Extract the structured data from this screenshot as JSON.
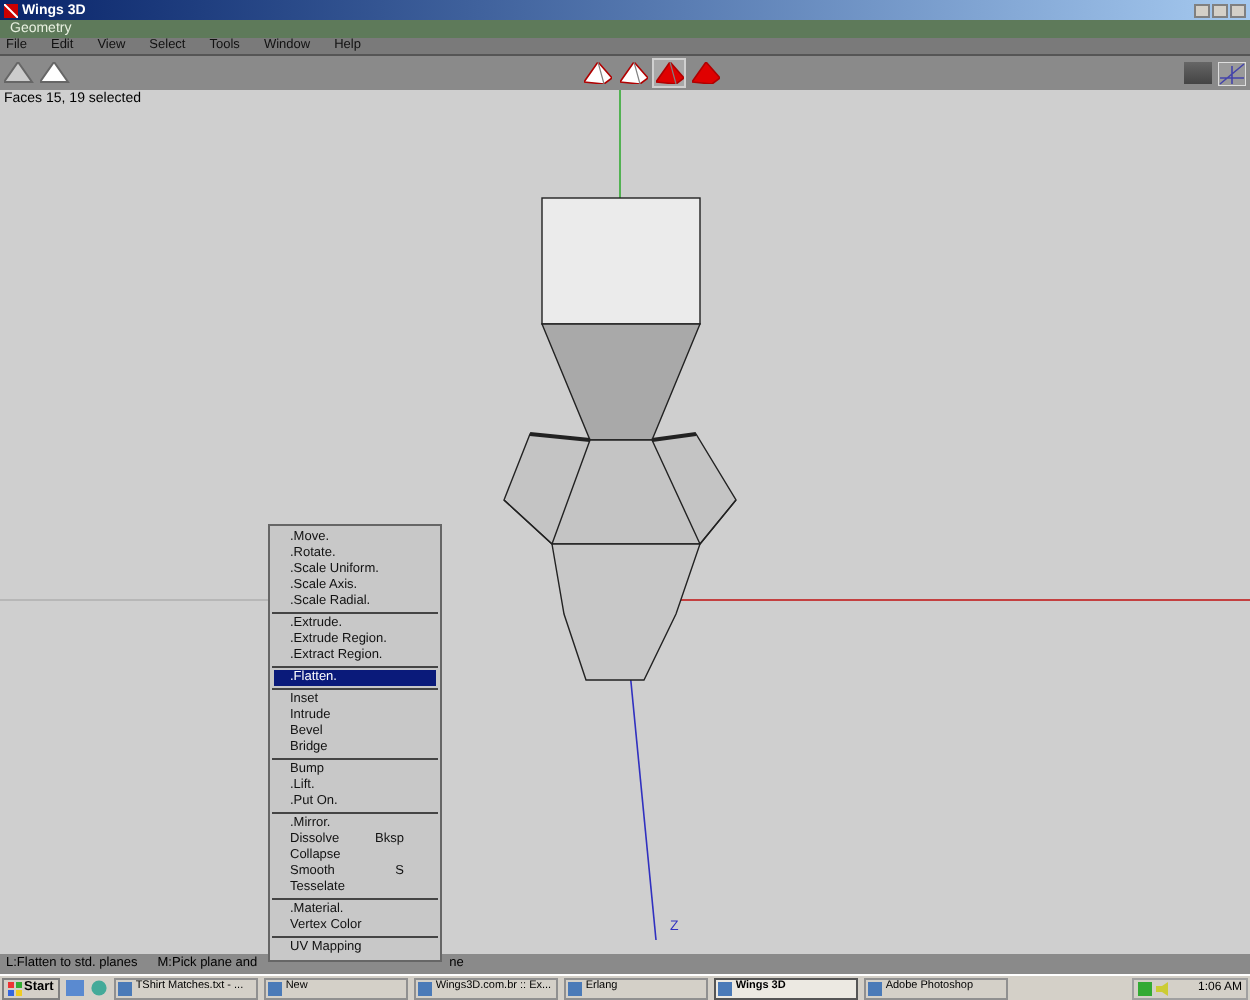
{
  "window": {
    "title": "Wings 3D"
  },
  "geometry_bar": {
    "title": "Geometry"
  },
  "menu_bar": [
    "File",
    "Edit",
    "View",
    "Select",
    "Tools",
    "Window",
    "Help"
  ],
  "selection_modes": [
    {
      "selected": false
    },
    {
      "selected": false
    },
    {
      "selected": true
    },
    {
      "selected": false
    }
  ],
  "viewport": {
    "info": "Faces 15, 19 selected",
    "axis_label": "Z"
  },
  "context_menu": [
    {
      "kind": "item",
      "label": ".Move.",
      "selected": false
    },
    {
      "kind": "item",
      "label": ".Rotate.",
      "selected": false
    },
    {
      "kind": "item",
      "label": ".Scale Uniform.",
      "selected": false
    },
    {
      "kind": "item",
      "label": ".Scale Axis.",
      "selected": false
    },
    {
      "kind": "item",
      "label": ".Scale Radial.",
      "selected": false
    },
    {
      "kind": "separator"
    },
    {
      "kind": "item",
      "label": ".Extrude.",
      "selected": false
    },
    {
      "kind": "item",
      "label": ".Extrude Region.",
      "selected": false
    },
    {
      "kind": "item",
      "label": ".Extract Region.",
      "selected": false
    },
    {
      "kind": "separator"
    },
    {
      "kind": "item",
      "label": ".Flatten.",
      "selected": true
    },
    {
      "kind": "separator"
    },
    {
      "kind": "item",
      "label": "Inset",
      "selected": false
    },
    {
      "kind": "item",
      "label": "Intrude",
      "selected": false
    },
    {
      "kind": "item",
      "label": "Bevel",
      "selected": false
    },
    {
      "kind": "item",
      "label": "Bridge",
      "selected": false
    },
    {
      "kind": "separator"
    },
    {
      "kind": "item",
      "label": "Bump",
      "selected": false
    },
    {
      "kind": "item",
      "label": ".Lift.",
      "selected": false
    },
    {
      "kind": "item",
      "label": ".Put On.",
      "selected": false
    },
    {
      "kind": "separator"
    },
    {
      "kind": "item",
      "label": ".Mirror.",
      "selected": false
    },
    {
      "kind": "item",
      "label": "Dissolve",
      "shortcut": "Bksp",
      "selected": false
    },
    {
      "kind": "item",
      "label": "Collapse",
      "selected": false
    },
    {
      "kind": "item",
      "label": "Smooth",
      "shortcut": "S",
      "selected": false
    },
    {
      "kind": "item",
      "label": "Tesselate",
      "selected": false
    },
    {
      "kind": "separator"
    },
    {
      "kind": "item",
      "label": ".Material.",
      "selected": false
    },
    {
      "kind": "item",
      "label": "Vertex Color",
      "selected": false
    },
    {
      "kind": "separator"
    },
    {
      "kind": "item",
      "label": "UV Mapping",
      "selected": false
    }
  ],
  "status_bar": [
    "L:Flatten to std. planes",
    "M:Pick plane and",
    "ne"
  ],
  "taskbar": {
    "start": "Start",
    "tasks": [
      {
        "label": "TShirt Matches.txt - ...",
        "selected": false
      },
      {
        "label": "New",
        "selected": false
      },
      {
        "label": "Wings3D.com.br :: Ex...",
        "selected": false
      },
      {
        "label": "Erlang",
        "selected": false
      },
      {
        "label": "Wings 3D",
        "selected": true
      },
      {
        "label": "Adobe Photoshop",
        "selected": false
      }
    ],
    "clock": "1:06 AM"
  }
}
